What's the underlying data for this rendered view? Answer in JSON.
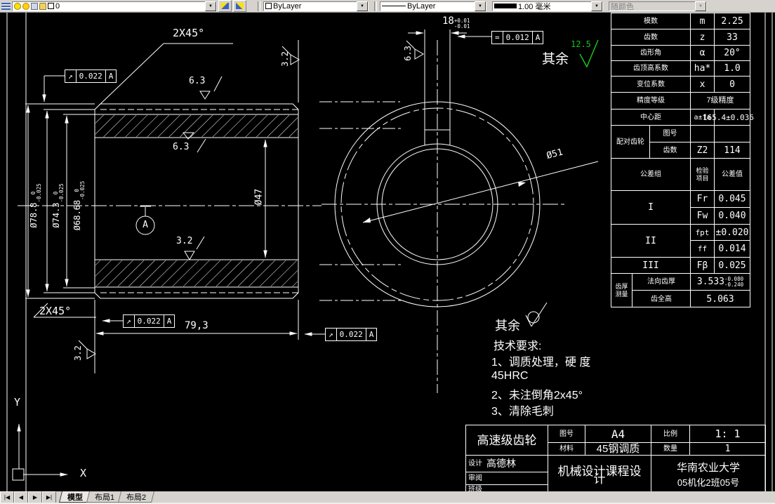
{
  "toolbar": {
    "layer_name": "0",
    "color_value": "ByLayer",
    "linetype_value": "ByLayer",
    "lineweight_value": "1.00 毫米",
    "plot_style_value": "随颜色",
    "dropdown_glyph": "▼"
  },
  "tab_bar": {
    "nav_first": "|◀",
    "nav_prev": "◀",
    "nav_next": "▶",
    "nav_last": "▶|",
    "model": "模型",
    "layout1": "布局1",
    "layout2": "布局2"
  },
  "ucs": {
    "x_label": "X",
    "y_label": "Y"
  },
  "drawing": {
    "chamfer": "2X45°",
    "dia78": {
      "v": "Ø78.8",
      "sup": "0",
      "sub": "-0.025"
    },
    "dia74": {
      "v": "Ø74.3",
      "sup": "0",
      "sub": "-0.025"
    },
    "dia68": {
      "v": "Ø68.68",
      "sup": "0",
      "sub": "-0.025"
    },
    "dia47": "Ø47",
    "dia51": "Ø51",
    "length": "79,3",
    "key18": {
      "v": "18",
      "sup": "+0.01",
      "sub": "-0.01"
    },
    "datum": "A",
    "sf63": "6.3",
    "sf32": "3.2",
    "sf125": "12.5",
    "qiyu": "其余",
    "runout": {
      "sym": "↗",
      "val": "0.022",
      "datum": "A"
    },
    "symmetry": {
      "sym": "=",
      "val": "0.012",
      "datum": "A"
    },
    "tech": {
      "title": "技术要求:",
      "l1": "1、调质处理，硬  度",
      "l2": "45HRC",
      "l3": "2、未注倒角2x45°",
      "l4": "3、清除毛刺"
    }
  },
  "gear_table": {
    "rows": [
      {
        "label": "模数",
        "sym": "m",
        "val": "2.25"
      },
      {
        "label": "齿数",
        "sym": "z",
        "val": "33"
      },
      {
        "label": "齿形角",
        "sym": "α",
        "val": "20°"
      },
      {
        "label": "齿顶高系数",
        "sym": "ha*",
        "val": "1.0"
      },
      {
        "label": "变位系数",
        "sym": "x",
        "val": "0"
      }
    ],
    "accuracy": {
      "label": "精度等级",
      "val": "7级精度"
    },
    "center_dist": {
      "label": "中心距",
      "sym": "a±fa",
      "val": "165.4±0.036"
    },
    "mate": {
      "group": "配对齿轮",
      "tuhao_label": "图号",
      "chishu_label": "齿数",
      "sym": "Z2",
      "val": "114"
    },
    "tol_header": {
      "c1": "公差组",
      "c2": "检验项目",
      "c3": "公差值"
    },
    "g1": {
      "label": "I",
      "r1": {
        "sym": "Fr",
        "val": "0.045"
      },
      "r2": {
        "sym": "Fw",
        "val": "0.040"
      }
    },
    "g2": {
      "label": "II",
      "r1": {
        "sym": "fpt",
        "val": "±0.020"
      },
      "r2": {
        "sym": "ff",
        "val": "0.014"
      }
    },
    "g3": {
      "label": "III",
      "sym": "Fβ",
      "val": "0.025"
    },
    "thickness": {
      "group": "齿厚测量",
      "r1_label": "法向齿厚",
      "r1_val": "3.533",
      "r1_sup": "-0.080",
      "r1_sub": "-0.240",
      "r2_label": "齿全高",
      "r2_val": "5.063"
    }
  },
  "title_block": {
    "part_name": "高速级齿轮",
    "tuhao_label": "图号",
    "tuhao_val": "A4",
    "material_label": "材料",
    "material_val": "45钢调质",
    "scale_label": "比例",
    "scale_val": "1: 1",
    "qty_label": "数量",
    "qty_val": "1",
    "design_label": "设计",
    "designer": "高德林",
    "review_label": "审阅",
    "class_label": "班级",
    "course": "机械设计课程设",
    "course_cont": "计",
    "school": "华南农业大学",
    "class_no": "05机化2班05号"
  }
}
